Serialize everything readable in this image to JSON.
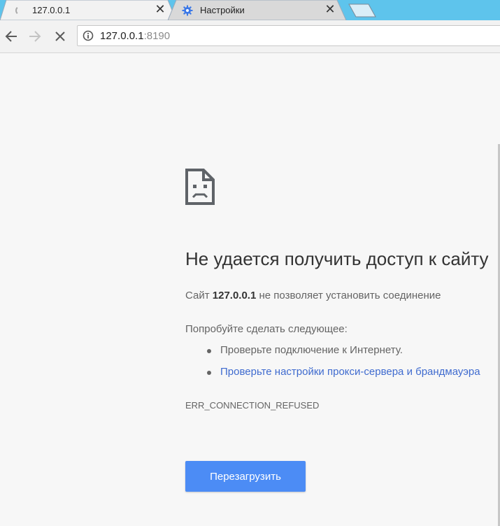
{
  "tabs": [
    {
      "title": "127.0.0.1",
      "icon": "loading-spinner-icon",
      "active": true
    },
    {
      "title": "Настройки",
      "icon": "gear-icon",
      "active": false
    }
  ],
  "toolbar": {
    "url_host": "127.0.0.1",
    "url_port": ":8190"
  },
  "error": {
    "title": "Не удается получить доступ к сайту",
    "desc_prefix": "Сайт ",
    "desc_host": "127.0.0.1",
    "desc_suffix": " не позволяет установить соединение",
    "suggestions_heading": "Попробуйте сделать следующее:",
    "suggestions": [
      {
        "text": "Проверьте подключение к Интернету.",
        "is_link": false
      },
      {
        "text": "Проверьте настройки прокси-сервера и брандмауэра",
        "is_link": true
      }
    ],
    "code": "ERR_CONNECTION_REFUSED",
    "reload_label": "Перезагрузить"
  },
  "colors": {
    "tabstrip": "#5ec4ec",
    "button": "#4c8cf5",
    "link": "#3f6bcf"
  }
}
